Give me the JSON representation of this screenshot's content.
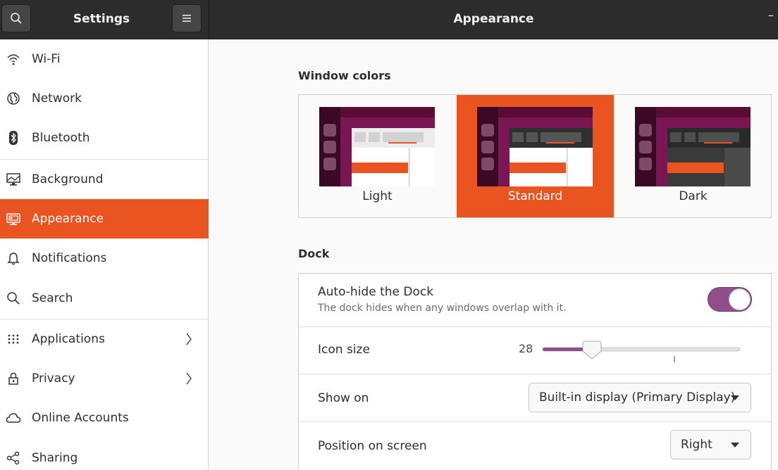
{
  "header": {
    "sidebar_title": "Settings",
    "main_title": "Appearance",
    "minimize_glyph": "–"
  },
  "sidebar": {
    "items": [
      {
        "label": "Wi-Fi",
        "icon": "wifi-icon"
      },
      {
        "label": "Network",
        "icon": "network-globe-icon"
      },
      {
        "label": "Bluetooth",
        "icon": "bluetooth-icon"
      },
      {
        "label": "Background",
        "icon": "background-monitor-icon"
      },
      {
        "label": "Appearance",
        "icon": "appearance-icon",
        "active": true
      },
      {
        "label": "Notifications",
        "icon": "bell-icon"
      },
      {
        "label": "Search",
        "icon": "search-icon"
      },
      {
        "label": "Applications",
        "icon": "apps-grid-icon",
        "has_submenu": true
      },
      {
        "label": "Privacy",
        "icon": "lock-icon",
        "has_submenu": true
      },
      {
        "label": "Online Accounts",
        "icon": "cloud-icon"
      },
      {
        "label": "Sharing",
        "icon": "share-icon"
      }
    ]
  },
  "main": {
    "window_colors": {
      "title": "Window colors",
      "options": [
        {
          "label": "Light"
        },
        {
          "label": "Standard",
          "selected": true
        },
        {
          "label": "Dark"
        }
      ]
    },
    "dock": {
      "title": "Dock",
      "autohide": {
        "label": "Auto-hide the Dock",
        "sublabel": "The dock hides when any windows overlap with it.",
        "enabled": true
      },
      "icon_size": {
        "label": "Icon size",
        "value": "28",
        "min": 16,
        "max": 64
      },
      "show_on": {
        "label": "Show on",
        "value": "Built-in display (Primary Display)"
      },
      "position": {
        "label": "Position on screen",
        "value": "Right"
      }
    }
  },
  "colors": {
    "accent": "#e95420",
    "toggle_on": "#924d8b",
    "header_bg": "#2c2c2c"
  }
}
